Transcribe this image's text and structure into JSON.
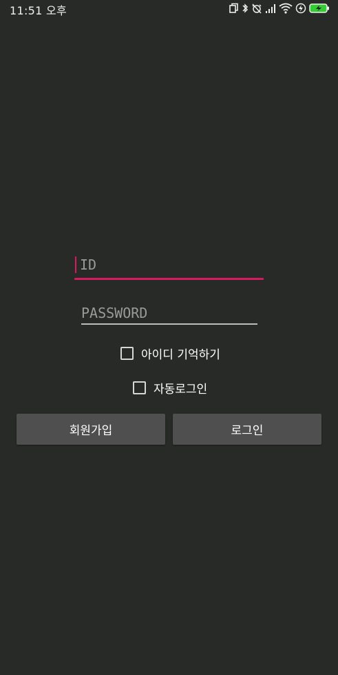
{
  "status_bar": {
    "time": "11:51 오후",
    "icons": [
      "copy-icon",
      "bluetooth-icon",
      "alarm-off-icon",
      "signal-icon",
      "wifi-icon",
      "data-saver-icon",
      "battery-charging-icon"
    ],
    "battery_color": "#33cc33"
  },
  "login_form": {
    "id_placeholder": "ID",
    "id_value": "",
    "password_placeholder": "PASSWORD",
    "password_value": "",
    "accent_color": "#d81b60",
    "remember_id_label": "아이디 기억하기",
    "remember_id_checked": false,
    "auto_login_label": "자동로그인",
    "auto_login_checked": false,
    "signup_label": "회원가입",
    "login_label": "로그인"
  }
}
